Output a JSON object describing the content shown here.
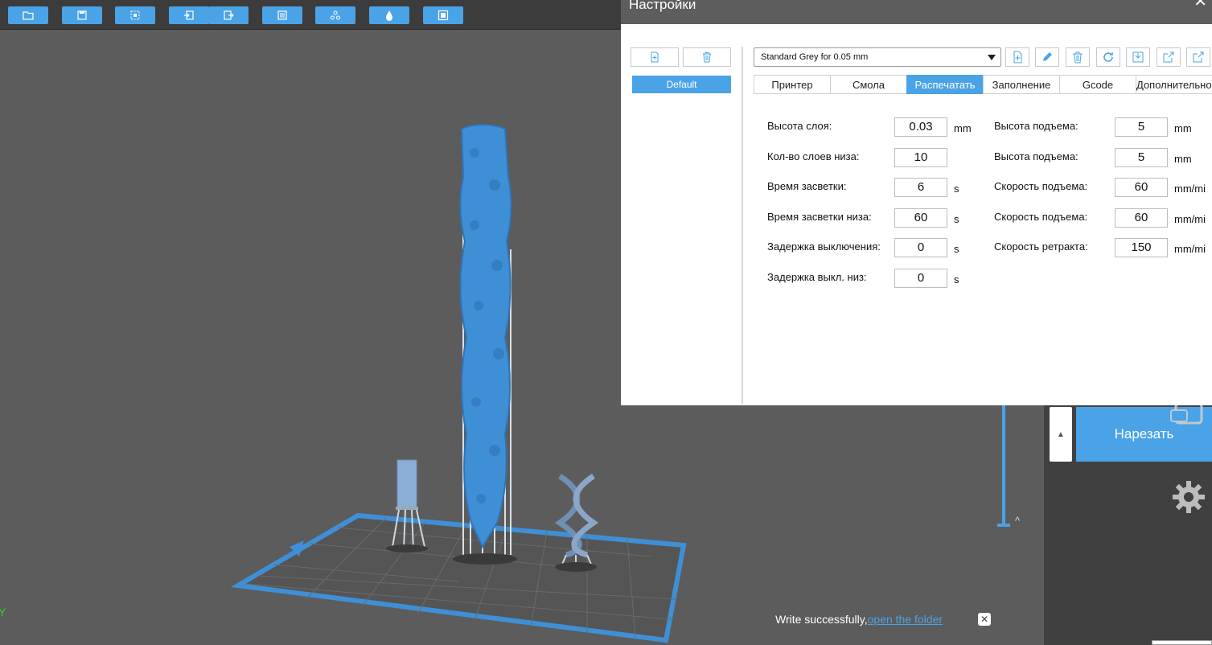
{
  "toolbar": {
    "buttons": [
      {
        "name": "open-file-icon"
      },
      {
        "name": "save-icon"
      },
      {
        "name": "select-all-icon"
      },
      {
        "name": "import-icon"
      },
      {
        "name": "export-icon"
      },
      {
        "name": "layers-icon"
      },
      {
        "name": "supports-icon"
      },
      {
        "name": "resin-icon"
      },
      {
        "name": "display-icon"
      }
    ]
  },
  "dialog": {
    "title": "Настройки",
    "profiles": [
      "Default"
    ],
    "preset_select": "Standard Grey for 0.05 mm",
    "tabs": [
      "Принтер",
      "Смола",
      "Распечатать",
      "Заполнение",
      "Gcode",
      "Дополнительно"
    ],
    "active_tab": "Распечатать",
    "left_fields": [
      {
        "label": "Высота слоя:",
        "value": "0.03",
        "unit": "mm"
      },
      {
        "label": "Кол-во слоев низа:",
        "value": "10",
        "unit": ""
      },
      {
        "label": "Время засветки:",
        "value": "6",
        "unit": "s"
      },
      {
        "label": "Время засветки низа:",
        "value": "60",
        "unit": "s"
      },
      {
        "label": "Задержка выключения:",
        "value": "0",
        "unit": "s"
      },
      {
        "label": "Задержка выкл. низ:",
        "value": "0",
        "unit": "s"
      }
    ],
    "right_fields": [
      {
        "label": "Высота подъема:",
        "value": "5",
        "unit": "mm"
      },
      {
        "label": "Высота подъема:",
        "value": "5",
        "unit": "mm"
      },
      {
        "label": "Скорость подъема:",
        "value": "60",
        "unit": "mm/mi"
      },
      {
        "label": "Скорость подъема:",
        "value": "60",
        "unit": "mm/mi"
      },
      {
        "label": "Скорость ретракта:",
        "value": "150",
        "unit": "mm/mi"
      }
    ]
  },
  "side": {
    "slice_label": "Нарезать"
  },
  "toast": {
    "message": "Write successfully,",
    "link": "open the folder"
  },
  "colors": {
    "accent": "#4aa3e6",
    "model": "#3f8fd6",
    "viewport": "#5c5c5c"
  }
}
